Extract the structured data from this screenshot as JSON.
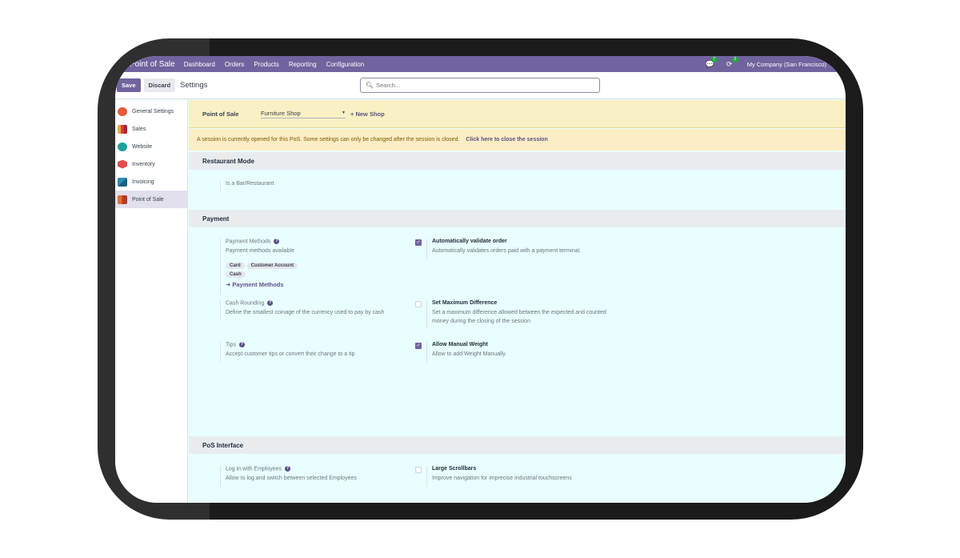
{
  "navbar": {
    "app_name": "Point of Sale",
    "menu": [
      "Dashboard",
      "Orders",
      "Products",
      "Reporting",
      "Configuration"
    ],
    "messages_icon": "chat-icon",
    "messages_count": "7",
    "activity_icon": "clock-icon",
    "activity_count": "2",
    "company": "My Company (San Francisco)",
    "color": "#71639e"
  },
  "control_panel": {
    "save_label": "Save",
    "discard_label": "Discard",
    "title": "Settings",
    "search_placeholder": "Search..."
  },
  "sidebar": {
    "items": [
      {
        "label": "General Settings",
        "icon": "general-settings-icon",
        "color": "#e55b3b"
      },
      {
        "label": "Sales",
        "icon": "sales-icon",
        "color": "#d93a3a"
      },
      {
        "label": "Website",
        "icon": "website-icon",
        "color": "#1aa39a"
      },
      {
        "label": "Inventory",
        "icon": "inventory-icon",
        "color": "#e14d4d"
      },
      {
        "label": "Invoicing",
        "icon": "invoicing-icon",
        "color": "#2b8fb0"
      },
      {
        "label": "Point of Sale",
        "icon": "point-of-sale-icon",
        "color": "#e0702e",
        "active": true
      }
    ]
  },
  "pos_bar": {
    "label": "Point of Sale",
    "shop": "Furniture Shop",
    "new_shop": "+ New Shop"
  },
  "alert": {
    "message": "A session is currently opened for this PoS. Some settings can only be changed after the session is closed.",
    "link": "Click here to close the session"
  },
  "sections": {
    "restaurant": {
      "title": "Restaurant Mode",
      "bar_restaurant": "Is a Bar/Restaurant"
    },
    "payment": {
      "title": "Payment",
      "payment_methods": {
        "title": "Payment Methods",
        "desc": "Payment methods available",
        "tags": [
          "Card",
          "Customer Account",
          "Cash"
        ],
        "link": "➜ Payment Methods"
      },
      "auto_validate": {
        "title": "Automatically validate order",
        "desc": "Automatically validates orders paid with a payment terminal.",
        "checked": true
      },
      "cash_rounding": {
        "title": "Cash Rounding",
        "desc": "Define the smallest coinage of the currency used to pay by cash"
      },
      "max_difference": {
        "title": "Set Maximum Difference",
        "desc": "Set a maximum difference allowed between the expected and counted money during the closing of the session",
        "checked": false
      },
      "tips": {
        "title": "Tips",
        "desc": "Accept customer tips or convert their change to a tip"
      },
      "manual_weight": {
        "title": "Allow Manual Weight",
        "desc": "Allow to add Weight Manually.",
        "checked": true
      }
    },
    "pos_interface": {
      "title": "PoS Interface",
      "login_employees": {
        "title": "Log in with Employees",
        "desc": "Allow to log and switch between selected Employees"
      },
      "large_scrollbars": {
        "title": "Large Scrollbars",
        "desc": "Improve navigation for imprecise industrial touchscreens",
        "checked": false
      }
    }
  }
}
